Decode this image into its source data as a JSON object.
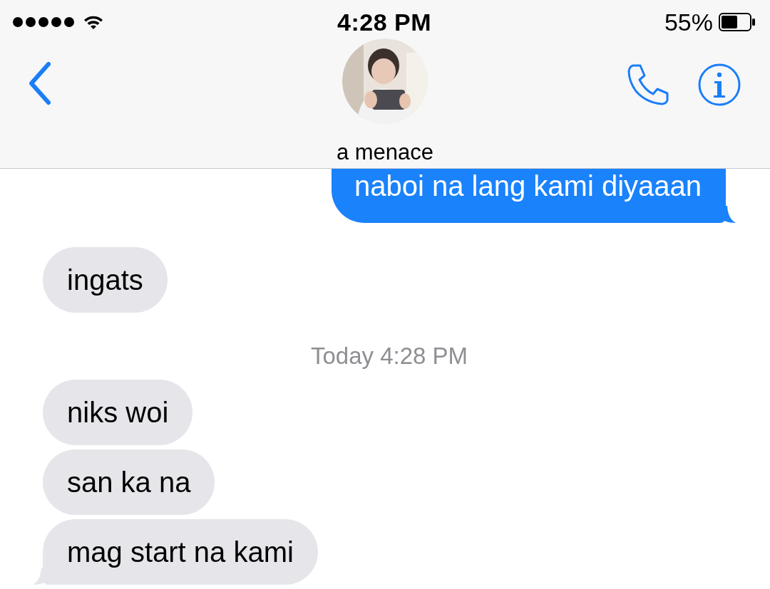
{
  "status_bar": {
    "time": "4:28 PM",
    "battery": "55%"
  },
  "header": {
    "contact_name": "a menace"
  },
  "messages": [
    {
      "kind": "sent",
      "text": "naboi na lang kami diyaaan",
      "tail": true
    },
    {
      "kind": "received",
      "text": "ingats",
      "tail": false
    },
    {
      "kind": "timestamp",
      "text": "Today 4:28 PM"
    },
    {
      "kind": "received",
      "text": "niks woi",
      "tail": false
    },
    {
      "kind": "received",
      "text": "san ka na",
      "tail": false
    },
    {
      "kind": "received",
      "text": "mag start na kami",
      "tail": true
    }
  ]
}
